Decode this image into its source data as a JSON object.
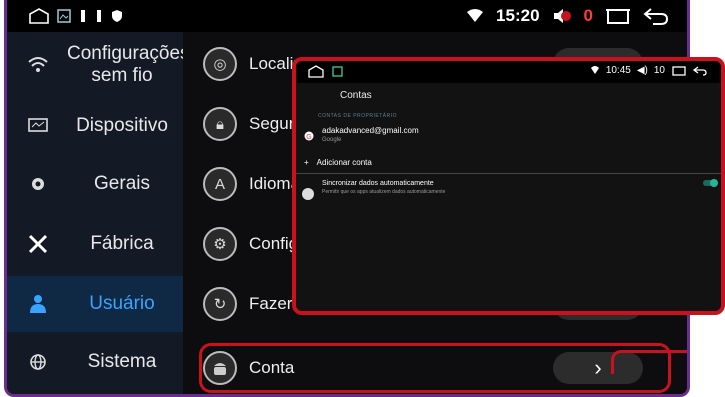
{
  "statusbar": {
    "time": "15:20",
    "volume": "0"
  },
  "sidebar": {
    "items": [
      {
        "icon": "wifi-icon",
        "label": "Configurações sem fio",
        "active": false
      },
      {
        "icon": "monitor-icon",
        "label": "Dispositivo",
        "active": false
      },
      {
        "icon": "gear-icon",
        "label": "Gerais",
        "active": false
      },
      {
        "icon": "tools-icon",
        "label": "Fábrica",
        "active": false
      },
      {
        "icon": "user-icon",
        "label": "Usuário",
        "active": true
      },
      {
        "icon": "globe-icon",
        "label": "Sistema",
        "active": false
      }
    ]
  },
  "main": {
    "rows": [
      {
        "icon": "location-icon",
        "label": "Localização"
      },
      {
        "icon": "lock-icon",
        "label": "Segurança"
      },
      {
        "icon": "language-icon",
        "label": "Idioma"
      },
      {
        "icon": "settings-icon",
        "label": "Configurações"
      },
      {
        "icon": "backup-icon",
        "label": "Fazer backup e redefinir"
      },
      {
        "icon": "android-icon",
        "label": "Conta"
      }
    ]
  },
  "popup": {
    "status_time": "10:45",
    "status_vol": "10",
    "title": "Contas",
    "section": "CONTAS DE PROPRIETÁRIO",
    "account_email": "adakadvanced@gmail.com",
    "account_type": "Google",
    "add_account": "Adicionar conta",
    "sync_title": "Sincronizar dados automaticamente",
    "sync_sub": "Permitir que os apps atualizem dados automaticamente"
  },
  "colors": {
    "accent": "#3aa3ff",
    "highlight": "#c8121e",
    "frame": "#6a2f8c"
  }
}
